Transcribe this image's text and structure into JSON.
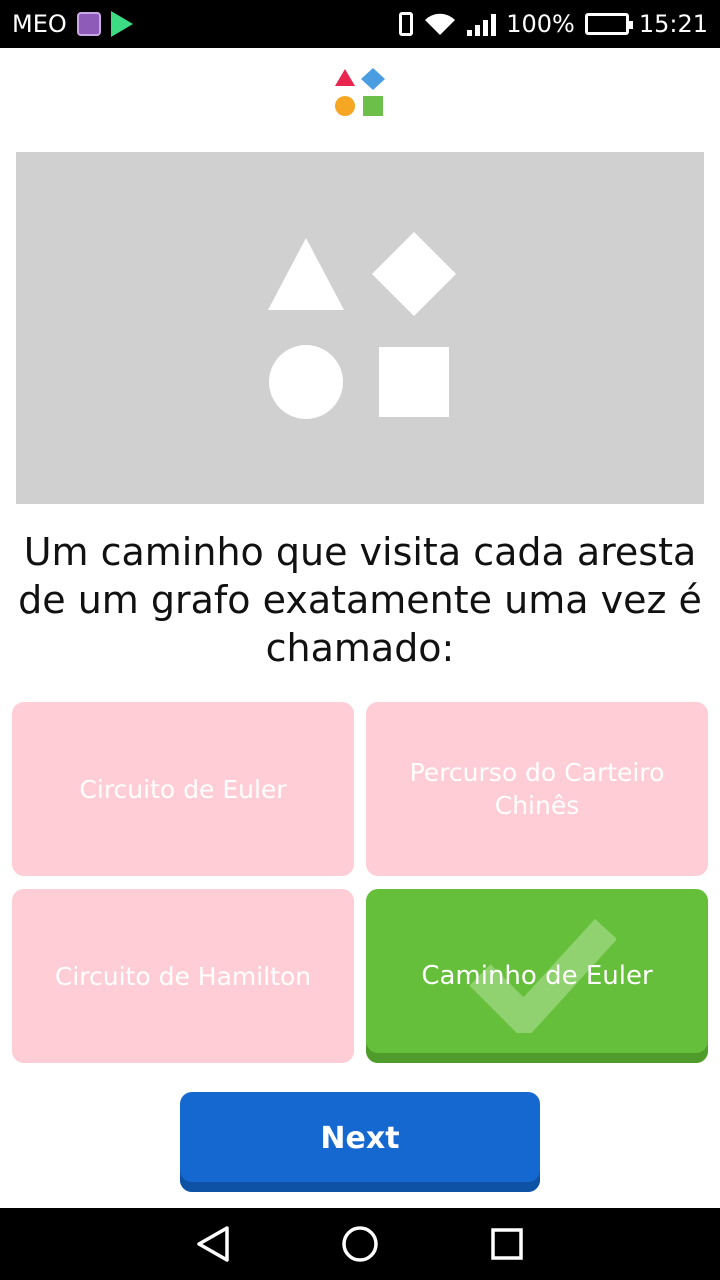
{
  "status_bar": {
    "carrier": "MEO",
    "battery": "100%",
    "time": "15:21",
    "icons": [
      "gallery-icon",
      "play-store-icon",
      "vibrate-icon",
      "wifi-icon",
      "signal-icon",
      "battery-icon"
    ]
  },
  "app": {
    "logo_icon": "shapes-logo-icon",
    "logo_colors": {
      "triangle": "#e8264f",
      "diamond": "#4a9de0",
      "circle": "#f5a623",
      "square": "#6cc04a"
    }
  },
  "question": {
    "text": "Um caminho que visita cada aresta de um grafo exatamente uma vez é chamado:"
  },
  "answers": [
    {
      "label": "Circuito de Euler",
      "state": "incorrect"
    },
    {
      "label": "Percurso do Carteiro Chinês",
      "state": "incorrect"
    },
    {
      "label": "Circuito de Hamilton",
      "state": "incorrect"
    },
    {
      "label": "Caminho de Euler",
      "state": "correct"
    }
  ],
  "colors": {
    "incorrect": "#ffcdd5",
    "correct": "#66bf3a",
    "primary": "#1468cf"
  },
  "next_button": {
    "label": "Next"
  },
  "nav_bar": {
    "icons": [
      "back-icon",
      "home-icon",
      "recents-icon"
    ]
  }
}
